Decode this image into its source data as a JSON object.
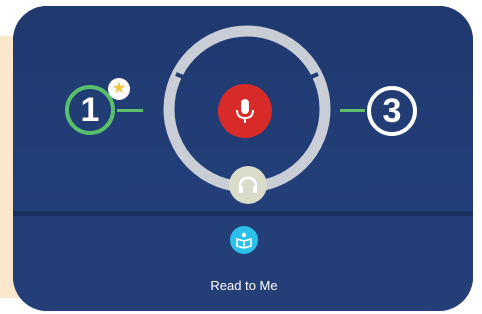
{
  "progress": {
    "step_left_label": "1",
    "step_right_label": "3",
    "star_icon": "star-icon"
  },
  "controls": {
    "mic_icon": "microphone-icon",
    "headphone_icon": "headphones-icon"
  },
  "footer": {
    "read_to_me_label": "Read to Me",
    "read_icon": "book-reader-icon"
  },
  "colors": {
    "card_bg": "#223b73",
    "accent_green": "#58c06a",
    "mic_red": "#d92a2a",
    "read_blue": "#2bc0e8",
    "star_yellow": "#f6c23e",
    "side_tan": "#fbe8cc"
  }
}
